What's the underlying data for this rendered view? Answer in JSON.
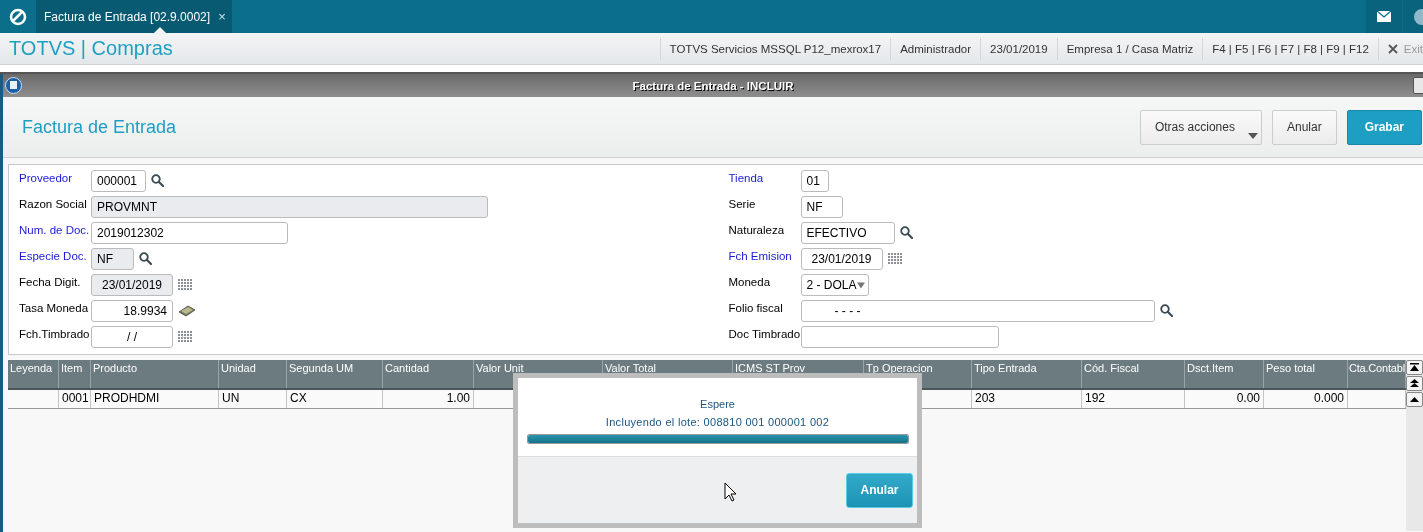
{
  "app_bar": {
    "tabs": [
      {
        "label": "Factura de Entrada [02.9.0002]",
        "close": "×",
        "selected": true
      }
    ]
  },
  "header": {
    "title": "TOTVS | Compras",
    "items": [
      "TOTVS Servicios MSSQL P12_mexrox17",
      "Administrador",
      "23/01/2019",
      "Empresa 1 / Casa Matriz",
      "F4 | F5 | F6 | F7 | F8 | F9 | F12"
    ],
    "exit": "Exit"
  },
  "window": {
    "title": "Factura de Entrada - INCLUIR",
    "heading": "Factura de Entrada",
    "buttons": [
      {
        "label": "Otras acciones",
        "kind": "menu"
      },
      {
        "label": "Anular",
        "kind": "plain"
      },
      {
        "label": "Grabar",
        "kind": "primary"
      }
    ]
  },
  "form": {
    "left": [
      {
        "label": "Proveedor",
        "value": "000001",
        "required": true,
        "readonly": false,
        "kind": "lookup"
      },
      {
        "label": "Razon Social",
        "value": "PROVMNT",
        "required": false,
        "readonly": true,
        "kind": "text"
      },
      {
        "label": "Num. de Doc.",
        "value": "2019012302",
        "required": true,
        "readonly": false,
        "kind": "text"
      },
      {
        "label": "Especie Doc.",
        "value": "NF",
        "required": true,
        "readonly": true,
        "kind": "lookup"
      },
      {
        "label": "Fecha Digit.",
        "value": "23/01/2019",
        "required": false,
        "readonly": true,
        "kind": "date"
      },
      {
        "label": "Tasa Moneda",
        "value": "18.9934",
        "required": false,
        "readonly": false,
        "kind": "calc"
      },
      {
        "label": "Fch.Timbrado",
        "value": "/ /",
        "required": false,
        "readonly": false,
        "kind": "date"
      }
    ],
    "right": [
      {
        "label": "Tienda",
        "value": "01",
        "required": true,
        "readonly": false,
        "kind": "text"
      },
      {
        "label": "Serie",
        "value": "NF",
        "required": false,
        "readonly": false,
        "kind": "text"
      },
      {
        "label": "Naturaleza",
        "value": "EFECTIVO",
        "required": false,
        "readonly": false,
        "kind": "lookup"
      },
      {
        "label": "Fch Emision",
        "value": "23/01/2019",
        "required": true,
        "readonly": false,
        "kind": "date"
      },
      {
        "label": "Moneda",
        "value": "2 - DOLA",
        "required": false,
        "readonly": false,
        "kind": "select"
      },
      {
        "label": "Folio fiscal",
        "value": "-   -   -   -",
        "required": false,
        "readonly": false,
        "kind": "lookup"
      },
      {
        "label": "Doc Timbrado",
        "required": false,
        "readonly": false,
        "kind": "text"
      }
    ]
  },
  "table": {
    "columns": [
      {
        "label": "Leyenda"
      },
      {
        "label": "Item"
      },
      {
        "label": "Producto"
      },
      {
        "label": "Unidad"
      },
      {
        "label": "Segunda UM"
      },
      {
        "label": "Cantidad"
      },
      {
        "label": "Valor Unit"
      },
      {
        "label": "Valor Total"
      },
      {
        "label": "ICMS ST Prov"
      },
      {
        "label": "Tp Operacion"
      },
      {
        "label": "Tipo Entrada"
      },
      {
        "label": "Cód. Fiscal"
      },
      {
        "label": "Dsct.Item"
      },
      {
        "label": "Peso total"
      },
      {
        "label": "Cta.Contabl"
      }
    ],
    "rows": [
      {
        "cells": [
          null,
          "0001",
          "PRODHDMI",
          "UN",
          "CX",
          "1.00",
          null,
          null,
          null,
          null,
          "203",
          "192",
          "0.00",
          "0.000",
          null
        ]
      }
    ]
  },
  "dialog": {
    "title": "Espere",
    "message": "Incluyendo el lote: 008810 001 000001 002",
    "level": 1,
    "button": "Anular"
  }
}
